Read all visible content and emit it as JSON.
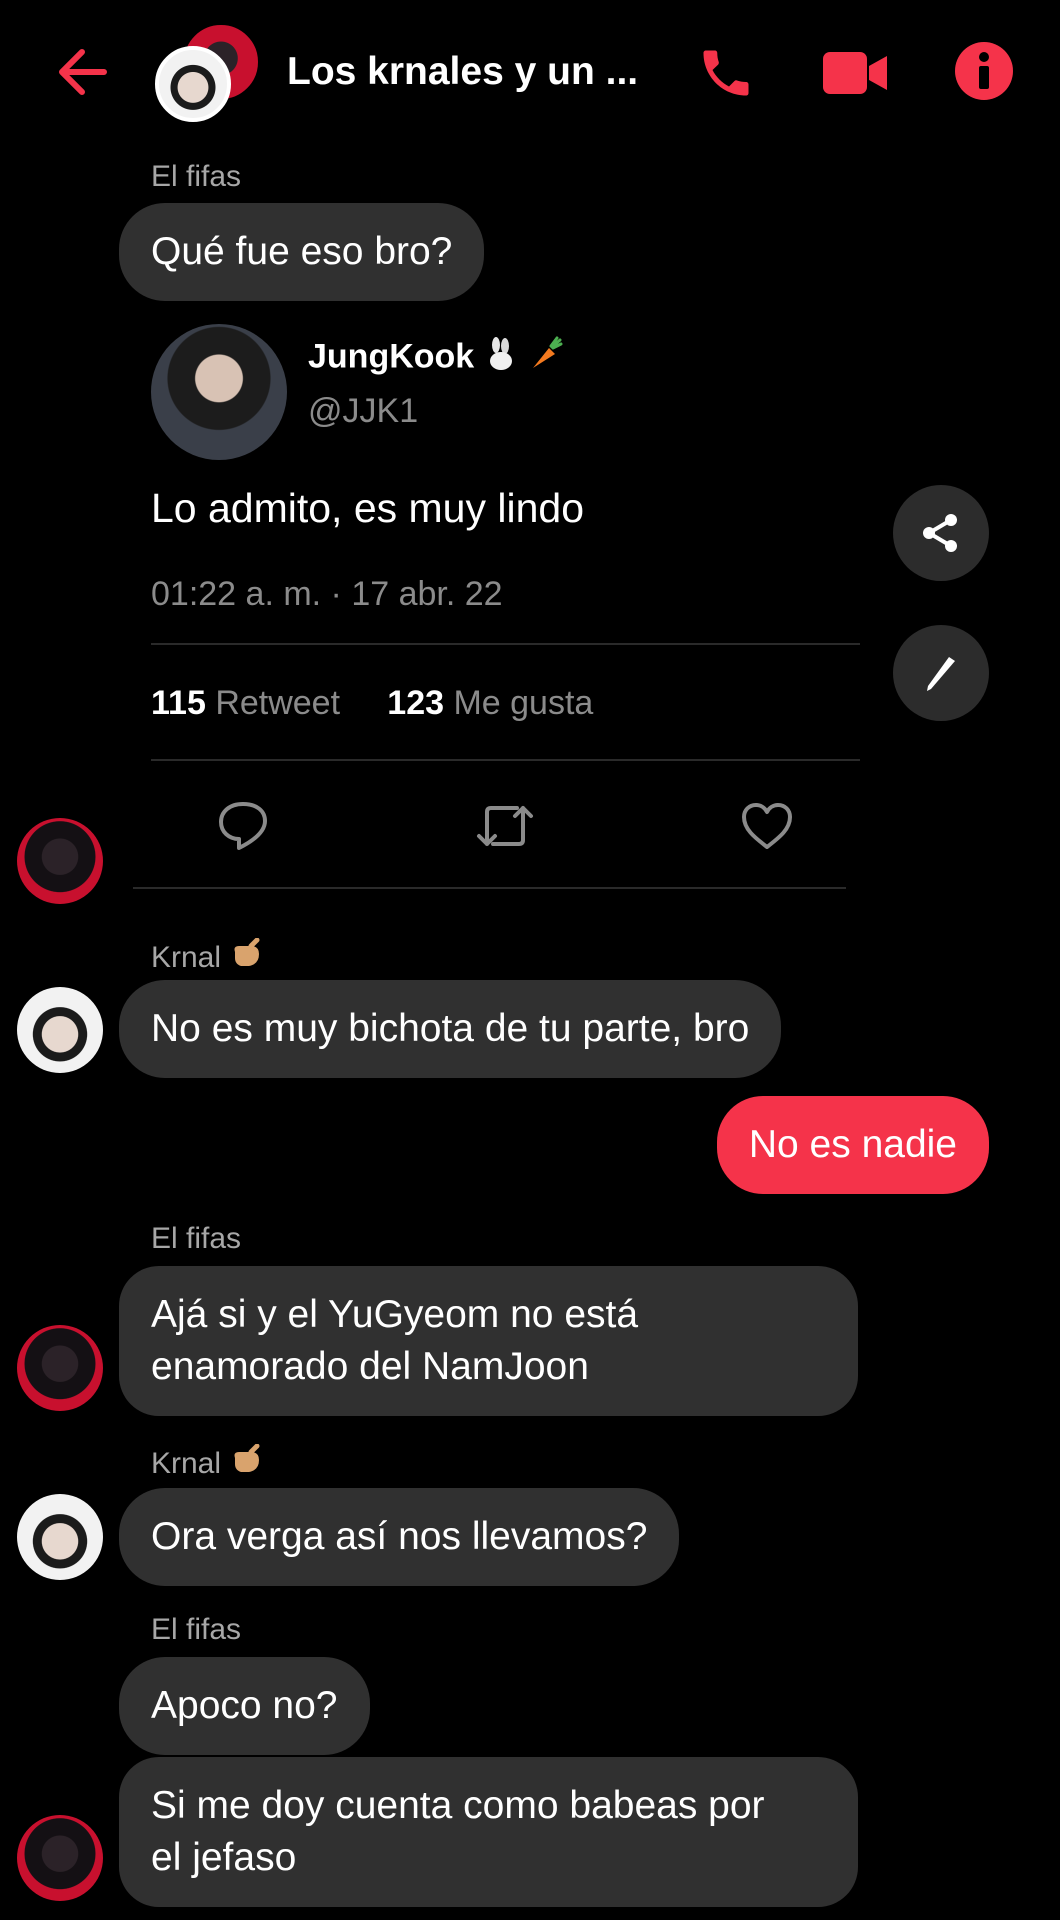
{
  "header": {
    "title": "Los krnales y un ...",
    "colors": {
      "accent": "#f5334a",
      "background": "#000000"
    }
  },
  "messages": [
    {
      "sender": "El fifas",
      "text": "Qué fue eso bro?"
    },
    {
      "sender": "Krnal",
      "text": "No es muy bichota de tu parte, bro"
    },
    {
      "own": true,
      "text": "No es nadie"
    },
    {
      "sender": "El fifas",
      "text": "Ajá si y el YuGyeom no está\nenamorado del NamJoon"
    },
    {
      "sender": "Krnal",
      "text": "Ora verga así nos llevamos?"
    },
    {
      "sender": "El fifas",
      "text": "Apoco no?"
    },
    {
      "text": "Si me doy cuenta como babeas por\nel jefaso"
    }
  ],
  "tweet": {
    "name": "JungKook",
    "handle": "@JJK1",
    "text": "Lo admito, es muy lindo",
    "time": "01:22 a. m. · 17 abr. 22",
    "retweets": "115",
    "retweets_label": "Retweet",
    "likes": "123",
    "likes_label": "Me gusta"
  },
  "icons": [
    "back-arrow-icon",
    "phone-icon",
    "video-icon",
    "info-icon",
    "share-icon",
    "pencil-icon",
    "reply-icon",
    "retweet-icon",
    "like-icon"
  ]
}
